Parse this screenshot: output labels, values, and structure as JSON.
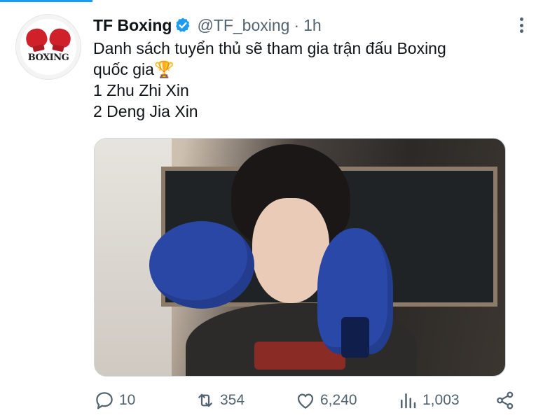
{
  "author": {
    "display_name": "TF Boxing",
    "handle": "@TF_boxing",
    "separator": "·",
    "time": "1h",
    "avatar_text": "BOXING"
  },
  "tweet": {
    "lines": [
      "Danh sách tuyển thủ sẽ tham gia trận đấu Boxing",
      "quốc gia🏆",
      "1 Zhu Zhi Xin",
      "2 Deng Jia Xin"
    ]
  },
  "actions": {
    "replies": "10",
    "retweets": "354",
    "likes": "6,240",
    "views": "1,003"
  },
  "colors": {
    "accent": "#1d9bf0",
    "text": "#0f1419",
    "secondary": "#536471"
  },
  "icons": [
    "verified-badge-icon",
    "more-options-icon",
    "reply-icon",
    "retweet-icon",
    "like-icon",
    "views-icon",
    "share-icon"
  ]
}
